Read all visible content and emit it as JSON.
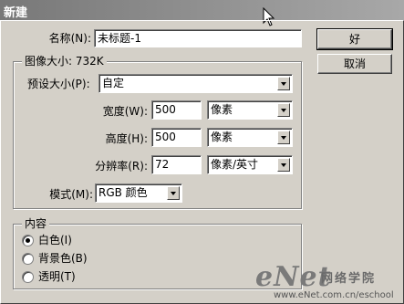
{
  "window": {
    "title": "新建"
  },
  "name": {
    "label": "名称(N):",
    "value": "未标题-1"
  },
  "buttons": {
    "ok": "好",
    "cancel": "取消"
  },
  "image_size": {
    "group_title": "图像大小: 732K",
    "preset_label": "预设大小(P):",
    "preset_value": "自定",
    "width_label": "宽度(W):",
    "width_value": "500",
    "width_unit": "像素",
    "height_label": "高度(H):",
    "height_value": "500",
    "height_unit": "像素",
    "resolution_label": "分辨率(R):",
    "resolution_value": "72",
    "resolution_unit": "像素/英寸",
    "mode_label": "模式(M):",
    "mode_value": "RGB 颜色"
  },
  "contents": {
    "group_title": "内容",
    "options": [
      {
        "label": "白色(I)",
        "selected": true
      },
      {
        "label": "背景色(B)",
        "selected": false
      },
      {
        "label": "透明(T)",
        "selected": false
      }
    ]
  },
  "watermark": {
    "logo": "eNet",
    "school": "网络学院",
    "url": "www.eNet.com.cn/eschool"
  }
}
